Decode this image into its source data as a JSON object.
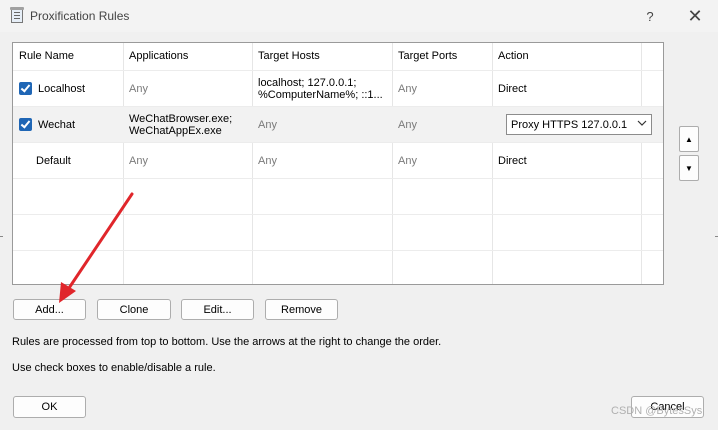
{
  "window": {
    "title": "Proxification Rules",
    "help_label": "?",
    "close_label": "✕"
  },
  "table": {
    "columns": [
      "Rule Name",
      "Applications",
      "Target Hosts",
      "Target Ports",
      "Action"
    ],
    "rows": [
      {
        "checked": true,
        "name": "Localhost",
        "applications": "Any",
        "target_hosts_line1": "localhost; 127.0.0.1;",
        "target_hosts_line2": "%ComputerName%; ::1...",
        "target_ports": "Any",
        "action": "Direct"
      },
      {
        "checked": true,
        "name": "Wechat",
        "applications_line1": "WeChatBrowser.exe;",
        "applications_line2": "WeChatAppEx.exe",
        "target_hosts": "Any",
        "target_ports": "Any",
        "action": "Proxy HTTPS 127.0.0.1"
      },
      {
        "checked": false,
        "name": "Default",
        "applications": "Any",
        "target_hosts": "Any",
        "target_ports": "Any",
        "action": "Direct"
      }
    ]
  },
  "side_buttons": {
    "up_label": "▲",
    "down_label": "▼"
  },
  "buttons": {
    "add": "Add...",
    "clone": "Clone",
    "edit": "Edit...",
    "remove": "Remove",
    "ok": "OK",
    "cancel": "Cancel"
  },
  "notes": {
    "order": "Rules are processed from top to bottom. Use the arrows at the right to change the order.",
    "checkboxes": "Use check boxes to enable/disable a rule."
  },
  "watermark": "CSDN @BytesSys",
  "colors": {
    "checkbox": "#1f66b5",
    "arrow": "#e0262b"
  }
}
